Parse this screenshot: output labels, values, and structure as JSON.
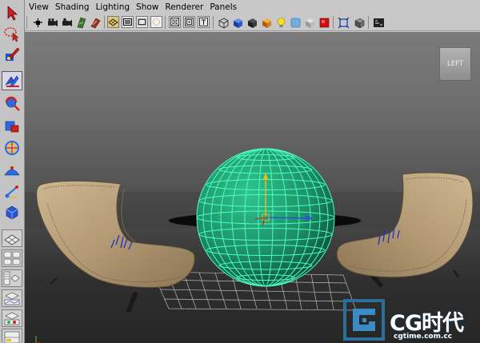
{
  "menu": {
    "items": [
      "View",
      "Shading",
      "Lighting",
      "Show",
      "Renderer",
      "Panels"
    ]
  },
  "toolbox": {
    "tools": [
      "select-tool",
      "lasso-tool",
      "paint-select-tool",
      "move-tool",
      "rotate-tool",
      "scale-tool",
      "universal-manipulator-tool",
      "soft-modification-tool",
      "show-manipulator-tool",
      "last-used-tool"
    ],
    "active_tool": "move-tool",
    "layouts": [
      "single-perspective-layout",
      "four-view-layout",
      "persp-outliner-layout",
      "persp-graph-layout",
      "persp-hypershade-layout",
      "persp-trax-layout"
    ]
  },
  "panel_toolbar": {
    "icons": [
      "select-camera-icon",
      "camera-attributes-icon",
      "bookmarks-icon",
      "image-plane-icon",
      "grid-icon",
      "film-gate-icon",
      "resolution-gate-icon",
      "gate-mask-icon",
      "field-chart-icon",
      "safe-action-icon",
      "wireframe-icon",
      "smooth-shade-icon",
      "wireframe-on-shaded-icon",
      "textured-icon",
      "use-all-lights-icon",
      "shadows-icon",
      "xray-icon",
      "xray-joints-icon",
      "backface-culling-icon",
      "isolate-select-icon",
      "viewport-2-icon"
    ]
  },
  "viewport": {
    "view_cube_label": "LEFT",
    "colors": {
      "wireframe_selected": "#4cffc0",
      "sphere_fill": "#1f9a72",
      "chair": "#b8a07c",
      "grid": "#b8b8b8"
    }
  },
  "watermark": {
    "name": "CG时代",
    "url": "cgtime.com.cc"
  }
}
